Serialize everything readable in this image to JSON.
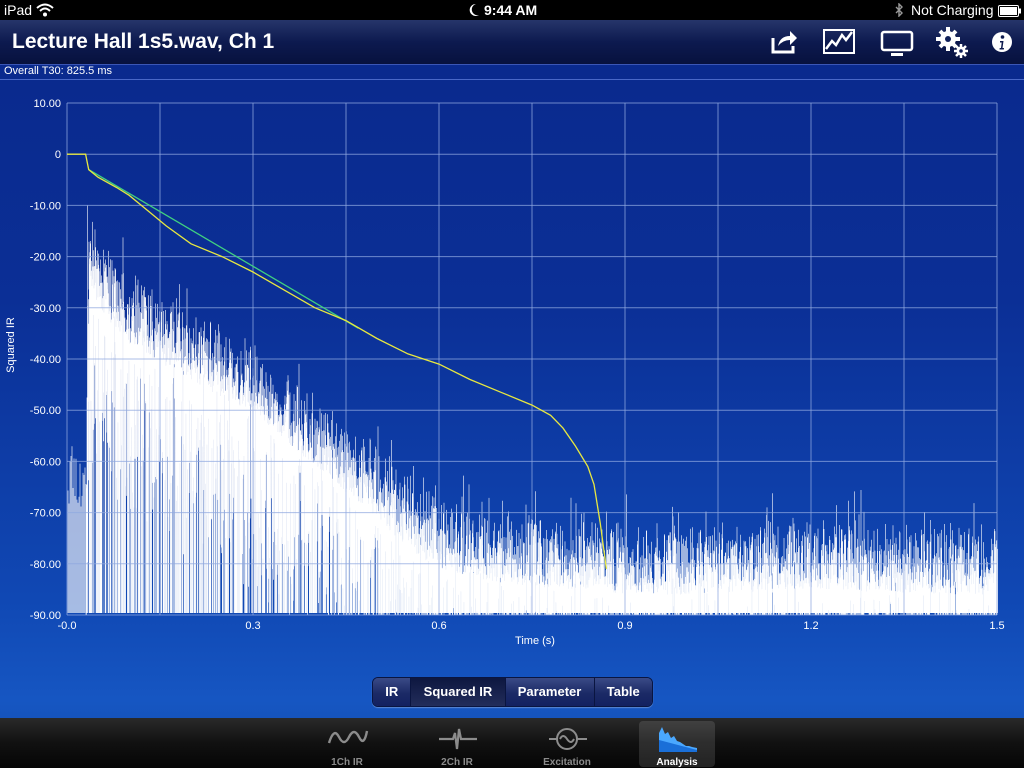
{
  "statusbar": {
    "device": "iPad",
    "time": "9:44 AM",
    "battery": "Not Charging",
    "icons": [
      "wifi-icon",
      "moon-icon",
      "bluetooth-icon",
      "battery-icon"
    ]
  },
  "navbar": {
    "title": "Lecture Hall 1s5.wav, Ch 1",
    "buttons": [
      "share-icon",
      "chart-icon",
      "display-icon",
      "settings-icon",
      "info-icon"
    ]
  },
  "info": {
    "t30": "Overall T30:  825.5 ms"
  },
  "chart_data": {
    "type": "line",
    "xlabel": "Time (s)",
    "ylabel": "Squared IR",
    "xlim": [
      0,
      1.5
    ],
    "ylim": [
      -90,
      10
    ],
    "x_ticks": [
      "-0.0",
      "0.3",
      "0.6",
      "0.9",
      "1.2",
      "1.5"
    ],
    "y_ticks": [
      "10.00",
      "0",
      "-10.00",
      "-20.00",
      "-30.00",
      "-40.00",
      "-50.00",
      "-60.00",
      "-70.00",
      "-80.00",
      "-90.00"
    ],
    "grid": true,
    "colors": {
      "background": "#0a2a8e",
      "grid": "#8fa8e0",
      "ir": "#ffffff",
      "decay": "#e8e840",
      "fit": "#40d080"
    },
    "series": [
      {
        "style": "decay-curve",
        "x": [
          0,
          0.03,
          0.035,
          0.05,
          0.08,
          0.1,
          0.13,
          0.16,
          0.2,
          0.25,
          0.3,
          0.35,
          0.4,
          0.45,
          0.5,
          0.55,
          0.6,
          0.65,
          0.7,
          0.75,
          0.78,
          0.8,
          0.82,
          0.84,
          0.85,
          0.86,
          0.87
        ],
        "values": [
          0,
          0,
          -3,
          -4.5,
          -6.5,
          -8,
          -11,
          -14,
          -17.5,
          -20,
          -23,
          -26.5,
          -30,
          -32.5,
          -36,
          -39,
          -41,
          -44,
          -46.5,
          -49,
          -51,
          -53.5,
          -57,
          -61,
          -64.5,
          -72,
          -81
        ]
      },
      {
        "style": "regression-line",
        "x": [
          0.035,
          0.47
        ],
        "values": [
          -3,
          -34
        ]
      },
      {
        "style": "squared-ir-envelope",
        "x": [
          0.03,
          0.035,
          0.05,
          0.1,
          0.15,
          0.2,
          0.25,
          0.3,
          0.35,
          0.4,
          0.45,
          0.5,
          0.55,
          0.6,
          0.7,
          0.8,
          0.9,
          1.0,
          1.2,
          1.4,
          1.5
        ],
        "values": [
          -60,
          -10,
          -16,
          -23,
          -27,
          -30,
          -34,
          -36,
          -42,
          -47,
          -52,
          -57,
          -63,
          -67,
          -70,
          -71,
          -72,
          -72,
          -71,
          -72,
          -72
        ]
      }
    ]
  },
  "segments": {
    "items": [
      "IR",
      "Squared IR",
      "Parameter",
      "Table"
    ],
    "active": "Squared IR"
  },
  "tabbar": {
    "tabs": [
      {
        "label": "1Ch IR",
        "icon": "sine-wave-icon"
      },
      {
        "label": "2Ch IR",
        "icon": "impulse-icon"
      },
      {
        "label": "Excitation",
        "icon": "signal-generator-icon"
      },
      {
        "label": "Analysis",
        "icon": "histogram-icon"
      }
    ],
    "active": "Analysis"
  }
}
